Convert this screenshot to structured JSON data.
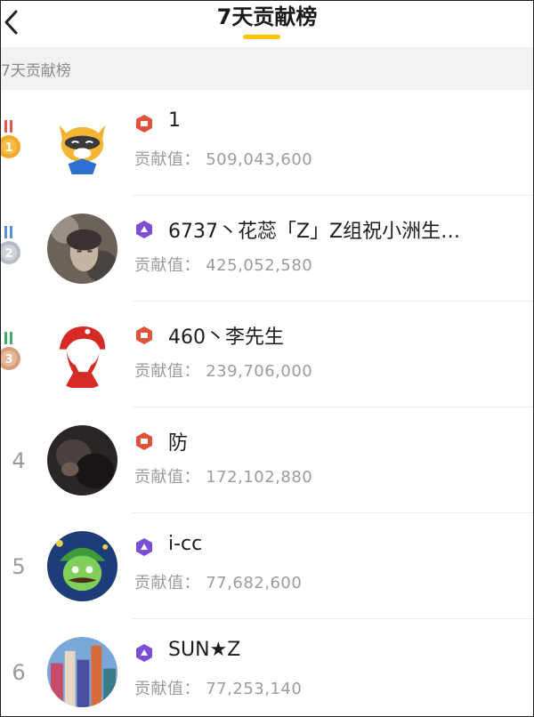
{
  "header": {
    "title": "7天贡献榜"
  },
  "section": {
    "label": "7天贡献榜"
  },
  "contribution_label": "贡献值：",
  "rows": [
    {
      "rank": "1",
      "name": "1",
      "value": "509,043,600",
      "badge": "gold",
      "medal": "gold"
    },
    {
      "rank": "2",
      "name": "6737丶花蕊「Z」Z组祝小洲生…",
      "value": "425,052,580",
      "badge": "purple",
      "medal": "silver"
    },
    {
      "rank": "3",
      "name": "460丶李先生",
      "value": "239,706,000",
      "badge": "gold",
      "medal": "bronze"
    },
    {
      "rank": "4",
      "name": "防",
      "value": "172,102,880",
      "badge": "gold",
      "medal": "none"
    },
    {
      "rank": "5",
      "name": "i-cc",
      "value": "77,682,600",
      "badge": "purple",
      "medal": "none"
    },
    {
      "rank": "6",
      "name": "SUN★Z",
      "value": "77,253,140",
      "badge": "purple",
      "medal": "none"
    }
  ],
  "colors": {
    "accent": "#ffc400",
    "badge_gold": "#e0523a",
    "badge_purple": "#7a4fd6"
  }
}
